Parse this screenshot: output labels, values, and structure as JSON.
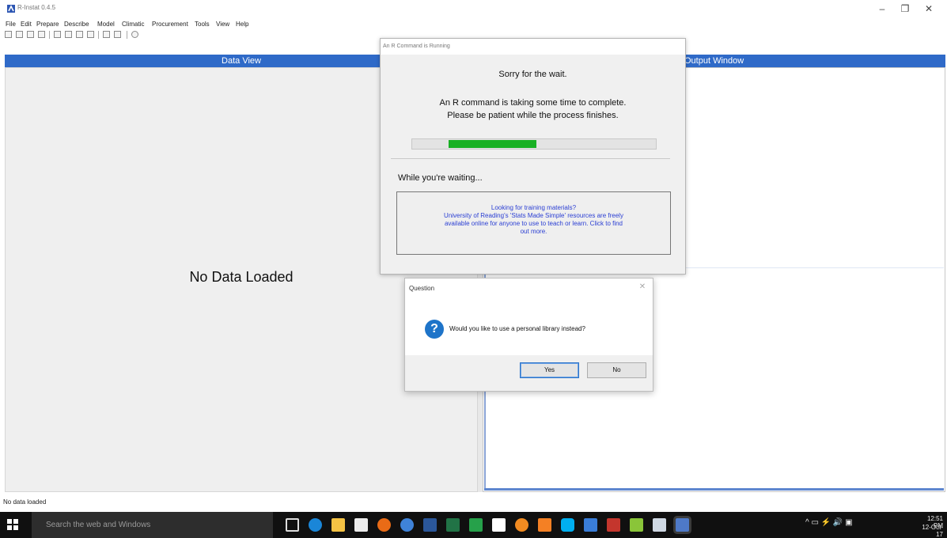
{
  "app": {
    "title": "R-Instat 0.4.5",
    "window_controls": [
      "–",
      "❐",
      "✕"
    ]
  },
  "menu": {
    "items": [
      "File",
      "Edit",
      "Prepare",
      "Describe",
      "Model",
      "Climatic",
      "Procurement",
      "Tools",
      "View",
      "Help"
    ]
  },
  "toolbar": {
    "icons": [
      "new-icon",
      "open-icon",
      "save-icon",
      "print-icon",
      "cut-icon",
      "copy-icon",
      "paste-icon",
      "window-icon",
      "layout-icon",
      "log-icon",
      "help-icon"
    ]
  },
  "panes": {
    "data_view_title": "Data View",
    "data_empty_message": "No Data Loaded",
    "output_title": "Output Window"
  },
  "status": {
    "text": "No data loaded"
  },
  "running_dialog": {
    "title": "An R Command is Running",
    "heading": "Sorry for the wait.",
    "message_line1": "An R command is taking some time to complete.",
    "message_line2": "Please be patient while the process finishes.",
    "progress_fraction_start": 0.15,
    "progress_fraction_end": 0.51,
    "progress_color": "#18b023",
    "waiting_label": "While you're waiting...",
    "tip_line1": "Looking for training materials?",
    "tip_line2": "University of Reading's 'Stats Made Simple' resources are freely",
    "tip_line3": "available online for anyone to use to teach or learn. Click to find",
    "tip_line4": "out more."
  },
  "question_dialog": {
    "title": "Question",
    "close_label": "✕",
    "icon": "question-icon",
    "message": "Would you like to use a personal library instead?",
    "yes_label": "Yes",
    "no_label": "No"
  },
  "taskbar": {
    "search_placeholder": "Search the web and Windows",
    "apps": [
      "task-view-icon",
      "edge-icon",
      "file-explorer-icon",
      "store-icon",
      "firefox-icon",
      "chrome-icon",
      "word-icon",
      "excel-icon",
      "app-icon",
      "notepad-icon",
      "app-icon-2",
      "vlc-icon",
      "skype-icon",
      "app-icon-3",
      "app-icon-4",
      "app-icon-5",
      "photos-icon",
      "r-instat-icon"
    ],
    "tray_glyphs": "^ ▭ ⚡ 🔊 ▣",
    "clock_time": "12:51 PM",
    "clock_date": "12-Oct-17"
  },
  "colors": {
    "header_blue": "#2f6ac8",
    "link_blue": "#2a3ed3",
    "button_focus": "#2e74c9"
  }
}
